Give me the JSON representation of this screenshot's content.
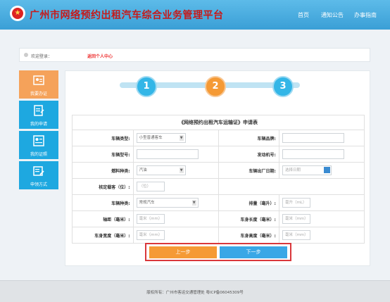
{
  "header": {
    "title": "广州市网络预约出租汽车综合业务管理平台",
    "nav": [
      {
        "label": "首页"
      },
      {
        "label": "通知公告"
      },
      {
        "label": "办事指南"
      }
    ]
  },
  "welcome": {
    "text": "欢迎登录：",
    "user_link": "返回个人中心"
  },
  "sidebar": {
    "items": [
      {
        "label": "我要办证",
        "icon": "id-card-icon",
        "active": true
      },
      {
        "label": "我的申请",
        "icon": "document-edit-icon"
      },
      {
        "label": "我的证照",
        "icon": "license-icon"
      },
      {
        "label": "申领方式",
        "icon": "apply-method-icon"
      }
    ]
  },
  "steps": [
    "1",
    "2",
    "3"
  ],
  "active_step": 2,
  "form": {
    "title": "《网络预约出租汽车运输证》申请表",
    "vehicle_type_label": "车辆类型:",
    "vehicle_type_value": "小型普通客车",
    "brand_label": "车辆品牌:",
    "model_label": "车辆型号:",
    "engine_label": "发动机号:",
    "fuel_label": "燃料种类:",
    "fuel_value": "汽油",
    "factory_date_label": "车辆出厂日期:",
    "factory_date_placeholder": "选择日期",
    "seats_label": "核定载客（位）:",
    "seats_placeholder": "（位）",
    "category_label": "车辆种类:",
    "category_value": "常规汽车",
    "displacement_label": "排量（毫升）:",
    "displacement_placeholder": "毫升（mL）",
    "wheelbase_label": "轴距（毫米）:",
    "wheelbase_placeholder": "毫米（mm）",
    "length_label": "车身长度（毫米）:",
    "length_placeholder": "毫米（mm）",
    "width_label": "车身宽度（毫米）:",
    "width_placeholder": "毫米（mm）",
    "height_label": "车身高度（毫米）:",
    "height_placeholder": "毫米（mm）"
  },
  "buttons": {
    "prev": "上一步",
    "next": "下一步"
  },
  "footer": {
    "text": "版权所有：广州市客运交通管理处 粤ICP备06045309号"
  },
  "colors": {
    "header_bg": "#3a9fd6",
    "title_red": "#c61a1a",
    "active_orange": "#f59a35",
    "step_blue": "#33b6e7",
    "next_blue": "#3aa7e6",
    "highlight_red": "#d9373b"
  }
}
